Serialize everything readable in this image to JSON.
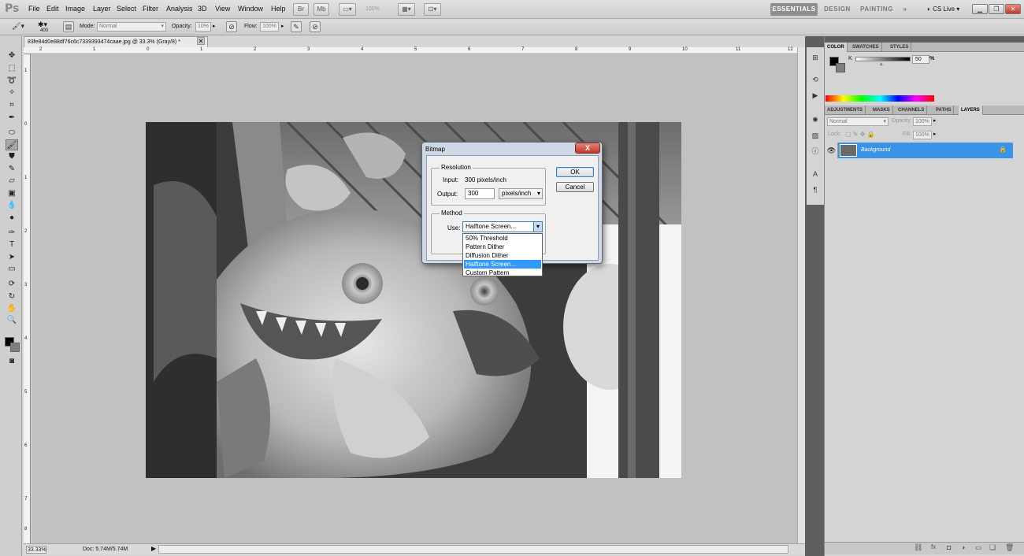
{
  "app": {
    "logo": "Ps"
  },
  "menu": [
    "File",
    "Edit",
    "Image",
    "Layer",
    "Select",
    "Filter",
    "Analysis",
    "3D",
    "View",
    "Window",
    "Help"
  ],
  "zoom_toolbar": "100%",
  "workspaces": {
    "essentials": "ESSENTIALS",
    "design": "DESIGN",
    "painting": "PAINTING",
    "more": "»",
    "cs_live": "CS Live"
  },
  "options": {
    "brush_size": "400",
    "mode_label": "Mode:",
    "mode_value": "Normal",
    "opacity_label": "Opacity:",
    "opacity_value": "10%",
    "flow_label": "Flow:",
    "flow_value": "100%"
  },
  "document": {
    "tab_title": "83fe84d0e88df76c6c7339393474caae.jpg @ 33.3% (Gray/8) *",
    "zoom": "33.33%",
    "doc_size": "Doc: 5.74M/5.74M",
    "ruler_top": [
      "2",
      "1",
      "0",
      "1",
      "2",
      "3",
      "4",
      "5",
      "6",
      "7",
      "8",
      "9",
      "10",
      "11",
      "12"
    ],
    "ruler_left": [
      "1",
      "0",
      "1",
      "2",
      "3",
      "4",
      "5",
      "6",
      "7",
      "8"
    ]
  },
  "dialog": {
    "title": "Bitmap",
    "close": "X",
    "resolution_title": "Resolution",
    "input_label": "Input:",
    "input_value": "300 pixels/inch",
    "output_label": "Output:",
    "output_value": "300",
    "output_unit": "pixels/inch",
    "method_title": "Method",
    "use_label": "Use:",
    "use_value": "Halftone Screen...",
    "ok": "OK",
    "cancel": "Cancel",
    "options": [
      "50% Threshold",
      "Pattern Dither",
      "Diffusion Dither",
      "Halftone Screen...",
      "Custom Pattern"
    ],
    "selected_index": 3
  },
  "color_panel": {
    "tabs": [
      "COLOR",
      "SWATCHES",
      "STYLES"
    ],
    "channel_label": "K",
    "value": "50",
    "unit": "%"
  },
  "layers_panel": {
    "tabs": [
      "ADJUSTMENTS",
      "MASKS",
      "CHANNELS",
      "PATHS",
      "LAYERS"
    ],
    "blend_mode": "Normal",
    "opacity_label": "Opacity:",
    "opacity_value": "100%",
    "lock_label": "Lock:",
    "fill_label": "Fill:",
    "fill_value": "100%",
    "layer_name": "Background"
  },
  "colors": {
    "selection": "#3399ff",
    "layer_selected": "#3b93e8",
    "dialog_close": "#c0392b"
  }
}
